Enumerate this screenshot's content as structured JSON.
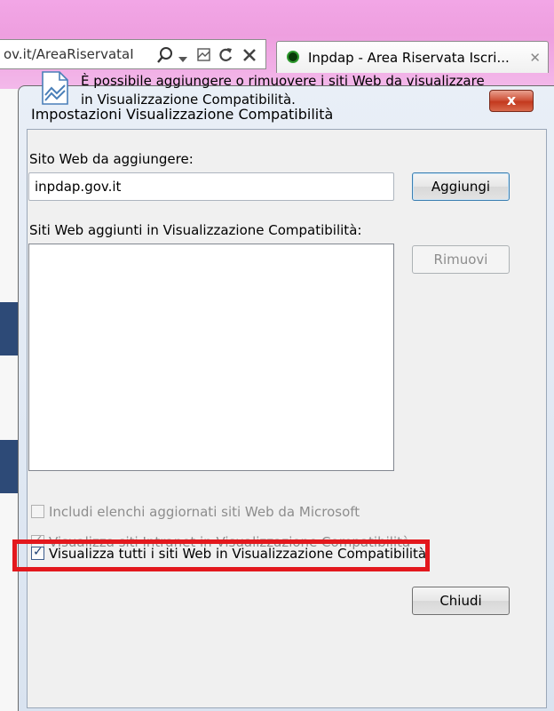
{
  "browser": {
    "address": "ov.it/AreaRiservataI",
    "tab_title": "Inpdap - Area Riservata Iscri...",
    "tab_close": "✕"
  },
  "dialog": {
    "title": "Impostazioni Visualizzazione Compatibilità",
    "close_glyph": "x",
    "info_text": "È possibile aggiungere o rimuovere i siti Web da visualizzare in Visualizzazione Compatibilità.",
    "add_label": "Sito Web da aggiungere:",
    "add_value": "inpdap.gov.it",
    "add_button": "Aggiungi",
    "list_label": "Siti Web aggiunti in Visualizzazione Compatibilità:",
    "sites": [],
    "remove_button": "Rimuovi",
    "options": [
      {
        "label": "Includi elenchi aggiornati siti Web da Microsoft",
        "checked": false,
        "enabled": false
      },
      {
        "label": "Visualizza siti Intranet in Visualizzazione Compatibilità",
        "checked": true,
        "enabled": false
      },
      {
        "label": "Visualizza tutti i siti Web in Visualizzazione Compatibilità",
        "checked": true,
        "enabled": true
      }
    ],
    "close_button": "Chiudi"
  },
  "colors": {
    "highlight": "#e3181d",
    "chrome_pink": "#ee9fdf"
  }
}
